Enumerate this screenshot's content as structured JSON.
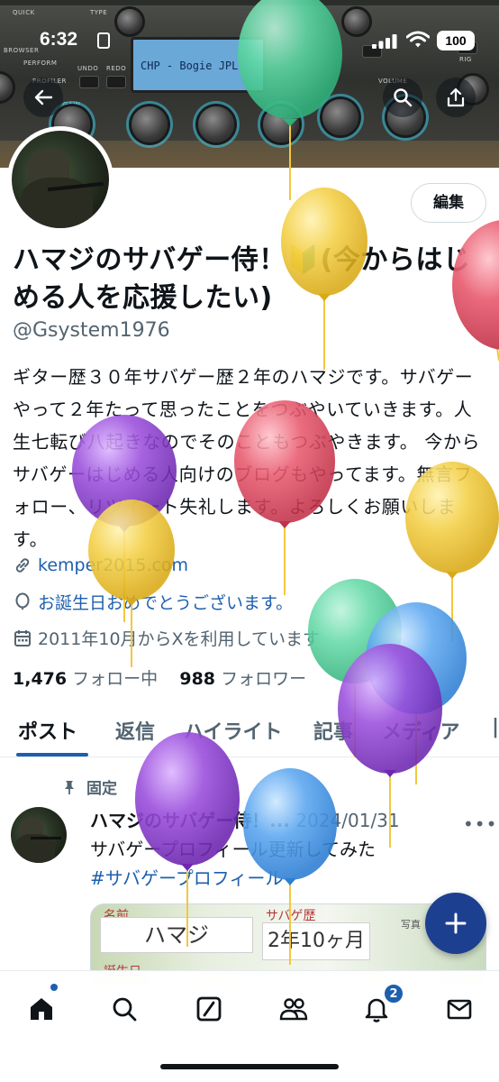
{
  "status_bar": {
    "time": "6:32",
    "battery": "100"
  },
  "banner": {
    "screen_text": "CHP - Bogie JPL",
    "labels": [
      "QUICK",
      "BROWSER",
      "PERFORM",
      "PROFILER",
      "UNDO",
      "REDO",
      "TYPE",
      "GAIN",
      "VOLUME",
      "RIG"
    ]
  },
  "header": {
    "edit_label": "編集"
  },
  "profile": {
    "name": "ハマジのサバゲー侍！🔰(今からはじめる人を応援したい)",
    "handle": "@Gsystem1976",
    "bio": "ギター歴３０年サバゲー歴２年のハマジです。サバゲーやって２年たって思ったことをつぶやいていきます。人生七転び八起きなのでそのこともつぶやきます。 今からサバゲーはじめる人向けのブログもやってます。無言フォロー、リツイート失礼します。よろしくお願いします。",
    "website": "kemper2015.com",
    "birthday": "お誕生日おめでとうございます。",
    "joined": "2011年10月からXを利用しています",
    "following_count": "1,476",
    "following_label": "フォロー中",
    "followers_count": "988",
    "followers_label": "フォロワー"
  },
  "tabs": [
    "ポスト",
    "返信",
    "ハイライト",
    "記事",
    "メディア"
  ],
  "pinned_post": {
    "pin_label": "固定",
    "author": "ハマジのサバゲー侍！...",
    "date": "2024/01/31",
    "text": "サバゲープロフィール更新してみた",
    "hashtag": "#サバゲープロフィール",
    "card": {
      "name_label": "名前",
      "name_value": "ハマジ",
      "history_label": "サバゲ歴",
      "history_value": "2年10ヶ月",
      "photo_label": "写真",
      "birthday_label": "誕生日"
    }
  },
  "bottom_nav": {
    "notification_badge": "2"
  },
  "balloon_colors": {
    "green": "#5fd8a4",
    "yellow": "#f3cf45",
    "red": "#e85a6e",
    "purple": "#9b4fdc",
    "blue": "#5ea8f0"
  },
  "colors": {
    "accent": "#1d5fae",
    "text": "#0f1419",
    "muted": "#536471"
  }
}
